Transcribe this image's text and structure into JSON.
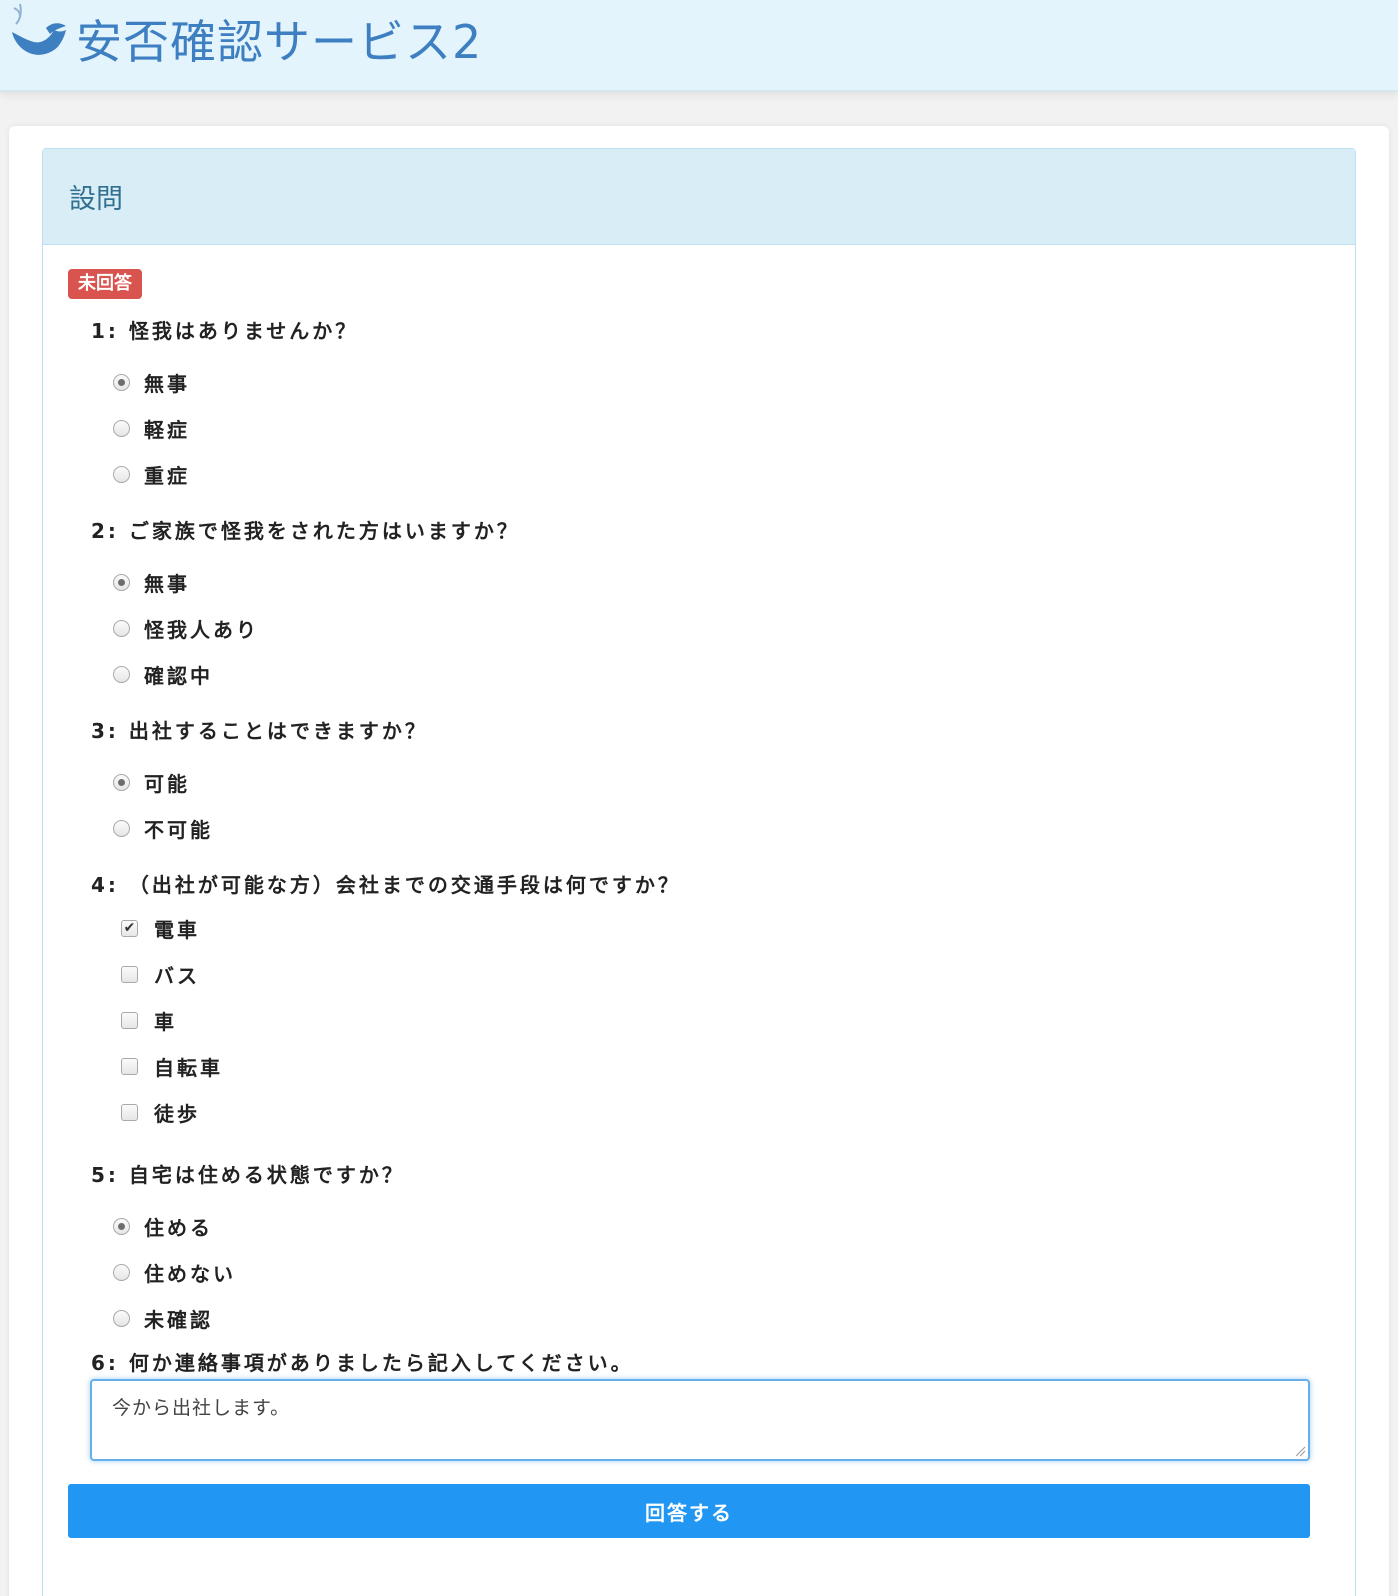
{
  "app": {
    "title": "安否確認サービス2",
    "logo_icon": "dove-icon"
  },
  "panel": {
    "title": "設問",
    "status_badge": "未回答"
  },
  "questions": [
    {
      "label": "1: 怪我はありませんか？",
      "type": "radio",
      "options": [
        {
          "label": "無事",
          "selected": true
        },
        {
          "label": "軽症",
          "selected": false
        },
        {
          "label": "重症",
          "selected": false
        }
      ]
    },
    {
      "label": "2: ご家族で怪我をされた方はいますか？",
      "type": "radio",
      "options": [
        {
          "label": "無事",
          "selected": true
        },
        {
          "label": "怪我人あり",
          "selected": false
        },
        {
          "label": "確認中",
          "selected": false
        }
      ]
    },
    {
      "label": "3: 出社することはできますか？",
      "type": "radio",
      "options": [
        {
          "label": "可能",
          "selected": true
        },
        {
          "label": "不可能",
          "selected": false
        }
      ]
    },
    {
      "label": "4: （出社が可能な方）会社までの交通手段は何ですか？",
      "type": "checkbox",
      "options": [
        {
          "label": "電車",
          "selected": true
        },
        {
          "label": "バス",
          "selected": false
        },
        {
          "label": "車",
          "selected": false
        },
        {
          "label": "自転車",
          "selected": false
        },
        {
          "label": "徒歩",
          "selected": false
        }
      ]
    },
    {
      "label": "5: 自宅は住める状態ですか？",
      "type": "radio",
      "options": [
        {
          "label": "住める",
          "selected": true
        },
        {
          "label": "住めない",
          "selected": false
        },
        {
          "label": "未確認",
          "selected": false
        }
      ]
    },
    {
      "label": "6: 何か連絡事項がありましたら記入してください。",
      "type": "textarea",
      "value": "今から出社します。"
    }
  ],
  "submit_label": "回答する",
  "colors": {
    "header_bg": "#e3f4fd",
    "title_blue": "#3d7fc1",
    "panel_heading_bg": "#d9edf7",
    "badge_red": "#d9534f",
    "submit_blue": "#2196f3"
  }
}
